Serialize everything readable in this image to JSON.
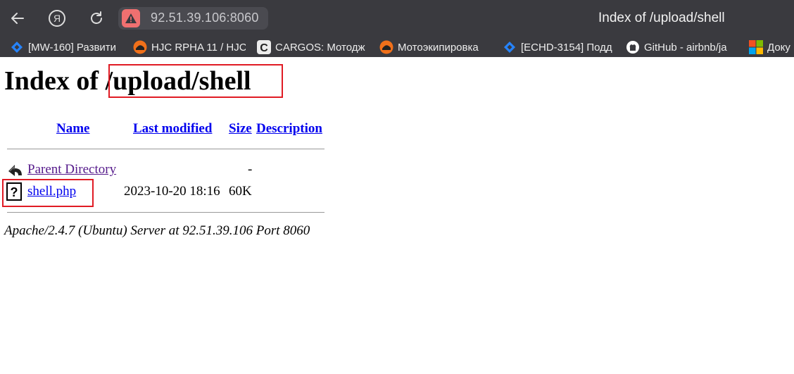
{
  "browser": {
    "url": "92.51.39.106:8060",
    "window_title": "Index of /upload/shell",
    "bookmarks": [
      {
        "label": "[MW-160] Развити",
        "icon": "jira-diamond-icon"
      },
      {
        "label": "HJC RPHA 11 / HJC",
        "icon": "moto-helmet-icon"
      },
      {
        "label": "CARGOS: Мотодж",
        "icon": "cargos-c-icon"
      },
      {
        "label": "Мотоэкипировка",
        "icon": "moto-helmet-icon"
      },
      {
        "label": "[ECHD-3154] Подд",
        "icon": "jira-diamond-icon"
      },
      {
        "label": "GitHub - airbnb/ja",
        "icon": "github-icon"
      },
      {
        "label": "Доку",
        "icon": "microsoft-icon"
      }
    ]
  },
  "page": {
    "heading_prefix": "Index of ",
    "heading_path": "/upload/shell",
    "columns": {
      "name": "Name",
      "last_modified": "Last modified",
      "size": "Size",
      "description": "Description"
    },
    "rows": [
      {
        "name": "Parent Directory",
        "modified": "",
        "size": "-",
        "icon": "back-arrow-icon"
      },
      {
        "name": "shell.php",
        "modified": "2023-10-20 18:16",
        "size": "60K",
        "icon": "unknown-file-icon"
      }
    ],
    "footer": "Apache/2.4.7 (Ubuntu) Server at 92.51.39.106 Port 8060"
  },
  "colors": {
    "chrome_bg": "#3a3a3f",
    "link": "#0000ee",
    "visited_link": "#551a8b",
    "highlight": "#e01b24",
    "warning": "#f07070"
  }
}
